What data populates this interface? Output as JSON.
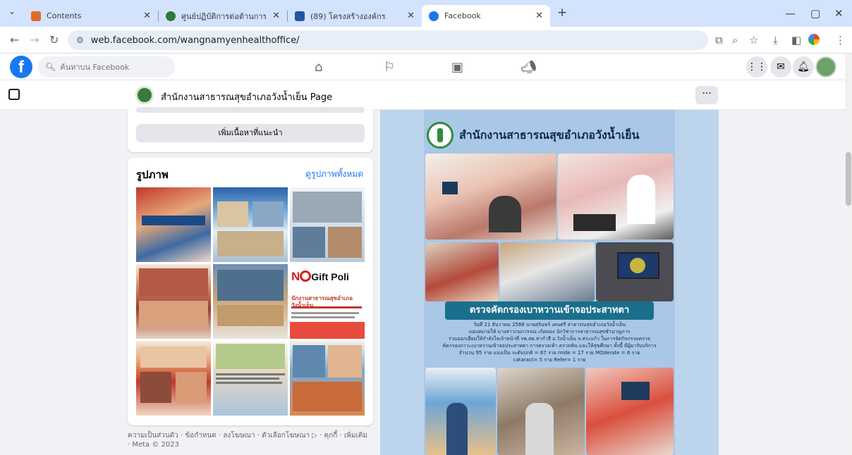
{
  "browser": {
    "tabs": [
      {
        "title": "Contents",
        "active": false
      },
      {
        "title": "ศูนย์ปฏิบัติการต่อต้านการทุจริต กระ",
        "active": false
      },
      {
        "title": "(89) โครงสร้างองค์กร",
        "active": false
      },
      {
        "title": "Facebook",
        "active": true
      }
    ],
    "new_tab_label": "+",
    "url": "web.facebook.com/wangnamyenhealthoffice/"
  },
  "fb": {
    "logo": "f",
    "search_placeholder": "ค้นหาบน Facebook"
  },
  "page": {
    "name": "สำนักงานสาธารณสุขอำเภอวังน้ำเย็น Page",
    "more_label": "···"
  },
  "sidebar": {
    "suggest_button": "เพิ่มเนื้อหาที่แนะนำ",
    "photos_title": "รูปภาพ",
    "see_all": "ดูรูปภาพทั้งหมด",
    "thumb_texts": {
      "gift_heading": "Gift Poli",
      "gift_text": "นักงานสาธารณสุขอำเภอวังน้ำเย็น"
    },
    "footer": "ความเป็นส่วนตัว · ข้อกำหนด · ลงโฆษณา · ตัวเลือกโฆษณา ▷ · คุกกี้ · เพิ่มเติม · Meta © 2023"
  },
  "post": {
    "heading": "สำนักงานสาธารณสุขอำเภอวังน้ำเย็น",
    "banner": "ตรวจคัดกรองเบาหวานเข้าจอประสาทตา",
    "caption_lines": [
      "วันที่ 21 ธันวาคม 2566 นายสุรินทร์ เคนศรี สาธารณสุขอำเภอวังน้ำเย็น",
      "มอบหมายให้ นางสาวกนกวรรณ เกิดทอง นักวิชาการสาธารณสุขชำนาญการ",
      "ร่วมออกเยี่ยมให้กำลังใจเจ้าหน้าที่ รพ.สต.ท่ากำสี อ.วังน้ำเย็น จ.สระแก้ว ในการจัดกิจกรรมตรวจ",
      "คัดกรองภาวะเบาหวานเข้าจอประสาทตา การตรวจเท้า ตรวจฟัน และให้สุขศึกษา ทั้งนี้ มีผู้มารับบริการ",
      "จำนวน 95 ราย แบ่งเป็น ระดับปกติ = 67 ราย mide = 17 ราย MOderate = 6 ราย",
      "cataract= 5 ราย Refer= 1 ราย"
    ]
  },
  "colors": {
    "fb_blue": "#1877f2",
    "tab_strip": "#d3e3fd",
    "post_bg": "#a9c7e6"
  }
}
